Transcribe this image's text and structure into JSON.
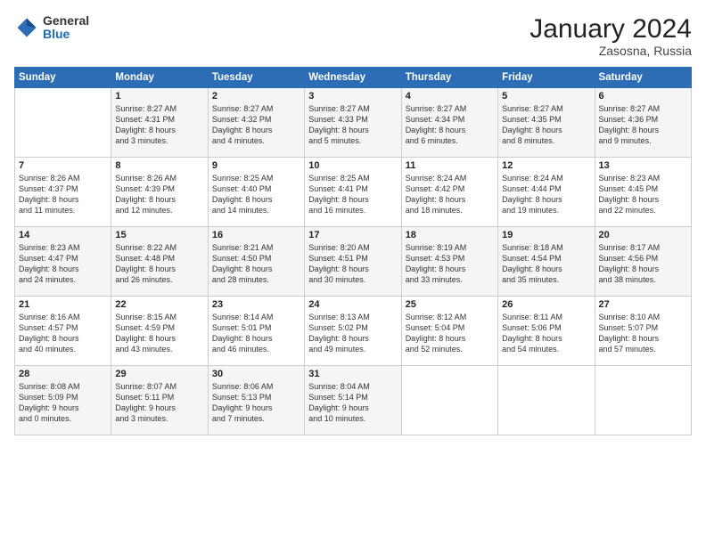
{
  "logo": {
    "general": "General",
    "blue": "Blue"
  },
  "title": "January 2024",
  "location": "Zasosna, Russia",
  "days_header": [
    "Sunday",
    "Monday",
    "Tuesday",
    "Wednesday",
    "Thursday",
    "Friday",
    "Saturday"
  ],
  "rows": [
    [
      {
        "day": "",
        "sunrise": "",
        "sunset": "",
        "daylight": ""
      },
      {
        "day": "1",
        "sunrise": "Sunrise: 8:27 AM",
        "sunset": "Sunset: 4:31 PM",
        "daylight": "Daylight: 8 hours and 3 minutes."
      },
      {
        "day": "2",
        "sunrise": "Sunrise: 8:27 AM",
        "sunset": "Sunset: 4:32 PM",
        "daylight": "Daylight: 8 hours and 4 minutes."
      },
      {
        "day": "3",
        "sunrise": "Sunrise: 8:27 AM",
        "sunset": "Sunset: 4:33 PM",
        "daylight": "Daylight: 8 hours and 5 minutes."
      },
      {
        "day": "4",
        "sunrise": "Sunrise: 8:27 AM",
        "sunset": "Sunset: 4:34 PM",
        "daylight": "Daylight: 8 hours and 6 minutes."
      },
      {
        "day": "5",
        "sunrise": "Sunrise: 8:27 AM",
        "sunset": "Sunset: 4:35 PM",
        "daylight": "Daylight: 8 hours and 8 minutes."
      },
      {
        "day": "6",
        "sunrise": "Sunrise: 8:27 AM",
        "sunset": "Sunset: 4:36 PM",
        "daylight": "Daylight: 8 hours and 9 minutes."
      }
    ],
    [
      {
        "day": "7",
        "sunrise": "Sunrise: 8:26 AM",
        "sunset": "Sunset: 4:37 PM",
        "daylight": "Daylight: 8 hours and 11 minutes."
      },
      {
        "day": "8",
        "sunrise": "Sunrise: 8:26 AM",
        "sunset": "Sunset: 4:39 PM",
        "daylight": "Daylight: 8 hours and 12 minutes."
      },
      {
        "day": "9",
        "sunrise": "Sunrise: 8:25 AM",
        "sunset": "Sunset: 4:40 PM",
        "daylight": "Daylight: 8 hours and 14 minutes."
      },
      {
        "day": "10",
        "sunrise": "Sunrise: 8:25 AM",
        "sunset": "Sunset: 4:41 PM",
        "daylight": "Daylight: 8 hours and 16 minutes."
      },
      {
        "day": "11",
        "sunrise": "Sunrise: 8:24 AM",
        "sunset": "Sunset: 4:42 PM",
        "daylight": "Daylight: 8 hours and 18 minutes."
      },
      {
        "day": "12",
        "sunrise": "Sunrise: 8:24 AM",
        "sunset": "Sunset: 4:44 PM",
        "daylight": "Daylight: 8 hours and 19 minutes."
      },
      {
        "day": "13",
        "sunrise": "Sunrise: 8:23 AM",
        "sunset": "Sunset: 4:45 PM",
        "daylight": "Daylight: 8 hours and 22 minutes."
      }
    ],
    [
      {
        "day": "14",
        "sunrise": "Sunrise: 8:23 AM",
        "sunset": "Sunset: 4:47 PM",
        "daylight": "Daylight: 8 hours and 24 minutes."
      },
      {
        "day": "15",
        "sunrise": "Sunrise: 8:22 AM",
        "sunset": "Sunset: 4:48 PM",
        "daylight": "Daylight: 8 hours and 26 minutes."
      },
      {
        "day": "16",
        "sunrise": "Sunrise: 8:21 AM",
        "sunset": "Sunset: 4:50 PM",
        "daylight": "Daylight: 8 hours and 28 minutes."
      },
      {
        "day": "17",
        "sunrise": "Sunrise: 8:20 AM",
        "sunset": "Sunset: 4:51 PM",
        "daylight": "Daylight: 8 hours and 30 minutes."
      },
      {
        "day": "18",
        "sunrise": "Sunrise: 8:19 AM",
        "sunset": "Sunset: 4:53 PM",
        "daylight": "Daylight: 8 hours and 33 minutes."
      },
      {
        "day": "19",
        "sunrise": "Sunrise: 8:18 AM",
        "sunset": "Sunset: 4:54 PM",
        "daylight": "Daylight: 8 hours and 35 minutes."
      },
      {
        "day": "20",
        "sunrise": "Sunrise: 8:17 AM",
        "sunset": "Sunset: 4:56 PM",
        "daylight": "Daylight: 8 hours and 38 minutes."
      }
    ],
    [
      {
        "day": "21",
        "sunrise": "Sunrise: 8:16 AM",
        "sunset": "Sunset: 4:57 PM",
        "daylight": "Daylight: 8 hours and 40 minutes."
      },
      {
        "day": "22",
        "sunrise": "Sunrise: 8:15 AM",
        "sunset": "Sunset: 4:59 PM",
        "daylight": "Daylight: 8 hours and 43 minutes."
      },
      {
        "day": "23",
        "sunrise": "Sunrise: 8:14 AM",
        "sunset": "Sunset: 5:01 PM",
        "daylight": "Daylight: 8 hours and 46 minutes."
      },
      {
        "day": "24",
        "sunrise": "Sunrise: 8:13 AM",
        "sunset": "Sunset: 5:02 PM",
        "daylight": "Daylight: 8 hours and 49 minutes."
      },
      {
        "day": "25",
        "sunrise": "Sunrise: 8:12 AM",
        "sunset": "Sunset: 5:04 PM",
        "daylight": "Daylight: 8 hours and 52 minutes."
      },
      {
        "day": "26",
        "sunrise": "Sunrise: 8:11 AM",
        "sunset": "Sunset: 5:06 PM",
        "daylight": "Daylight: 8 hours and 54 minutes."
      },
      {
        "day": "27",
        "sunrise": "Sunrise: 8:10 AM",
        "sunset": "Sunset: 5:07 PM",
        "daylight": "Daylight: 8 hours and 57 minutes."
      }
    ],
    [
      {
        "day": "28",
        "sunrise": "Sunrise: 8:08 AM",
        "sunset": "Sunset: 5:09 PM",
        "daylight": "Daylight: 9 hours and 0 minutes."
      },
      {
        "day": "29",
        "sunrise": "Sunrise: 8:07 AM",
        "sunset": "Sunset: 5:11 PM",
        "daylight": "Daylight: 9 hours and 3 minutes."
      },
      {
        "day": "30",
        "sunrise": "Sunrise: 8:06 AM",
        "sunset": "Sunset: 5:13 PM",
        "daylight": "Daylight: 9 hours and 7 minutes."
      },
      {
        "day": "31",
        "sunrise": "Sunrise: 8:04 AM",
        "sunset": "Sunset: 5:14 PM",
        "daylight": "Daylight: 9 hours and 10 minutes."
      },
      {
        "day": "",
        "sunrise": "",
        "sunset": "",
        "daylight": ""
      },
      {
        "day": "",
        "sunrise": "",
        "sunset": "",
        "daylight": ""
      },
      {
        "day": "",
        "sunrise": "",
        "sunset": "",
        "daylight": ""
      }
    ]
  ]
}
